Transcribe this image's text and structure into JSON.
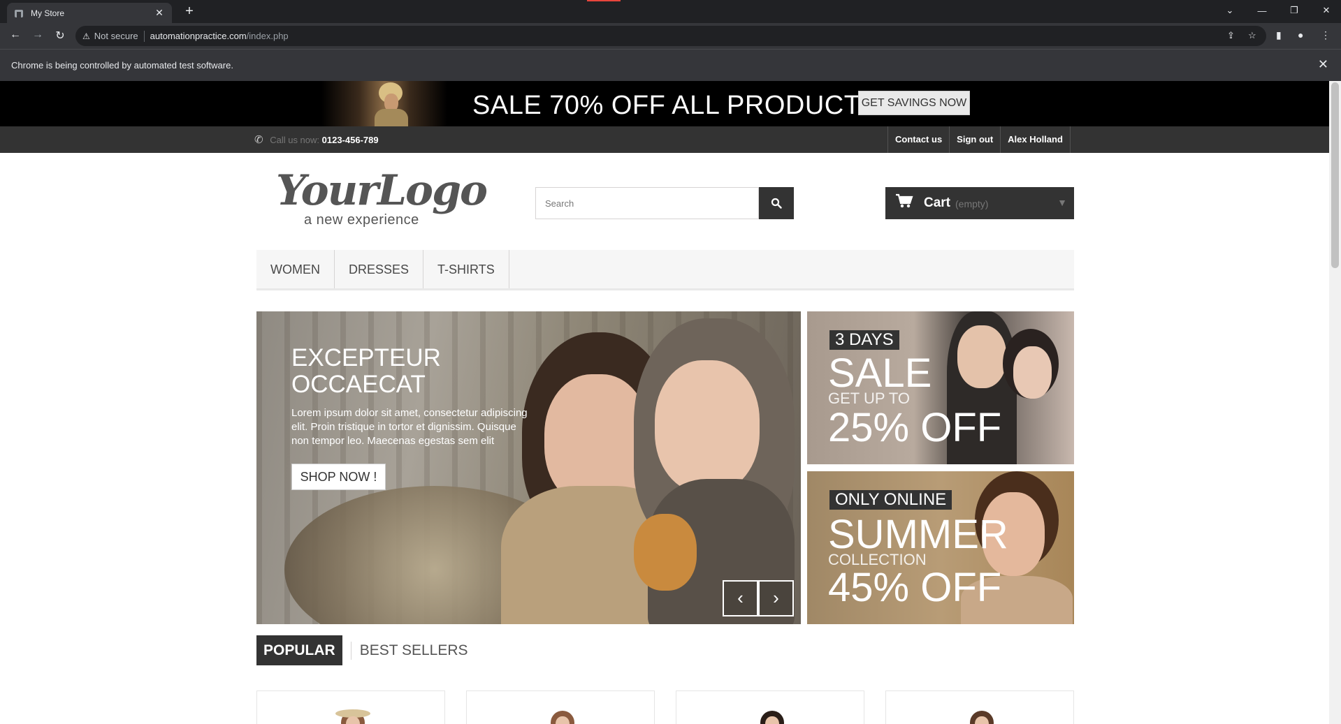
{
  "browser": {
    "tab_title": "My Store",
    "security_label": "Not secure",
    "url_host": "automationpractice.com",
    "url_path": "/index.php",
    "infobar_message": "Chrome is being controlled by automated test software."
  },
  "banner": {
    "headline": "SALE 70% OFF ALL PRODUCTS",
    "cta_label": "GET SAVINGS NOW"
  },
  "top_nav": {
    "call_label": "Call us now:",
    "phone": "0123-456-789",
    "links": [
      "Contact us",
      "Sign out",
      "Alex Holland"
    ]
  },
  "logo": {
    "wordmark": "YourLogo",
    "tagline": "a new experience"
  },
  "search": {
    "placeholder": "Search",
    "value": ""
  },
  "cart": {
    "label": "Cart",
    "status": "(empty)"
  },
  "menu": {
    "items": [
      "WOMEN",
      "DRESSES",
      "T-SHIRTS"
    ]
  },
  "hero": {
    "title": "EXCEPTEUR OCCAECAT",
    "body": "Lorem ipsum dolor sit amet, consectetur adipiscing elit. Proin tristique in tortor et dignissim. Quisque non tempor leo. Maecenas egestas sem elit",
    "button": "SHOP NOW !"
  },
  "promos": [
    {
      "tag": "3 DAYS",
      "big": "SALE",
      "mid": "GET UP TO",
      "big2": "25% OFF"
    },
    {
      "tag": "ONLY ONLINE",
      "big": "SUMMER",
      "mid": "COLLECTION",
      "big2": "45% OFF"
    }
  ],
  "tabs": {
    "active": "POPULAR",
    "inactive": "BEST SELLERS"
  },
  "colors": {
    "chrome_dark": "#202124",
    "chrome_mid": "#35363a",
    "nav_bg": "#333333",
    "menu_bg": "#f6f6f6"
  },
  "icons": {
    "phone": "phone-icon",
    "search": "search-icon",
    "cart": "cart-icon"
  }
}
